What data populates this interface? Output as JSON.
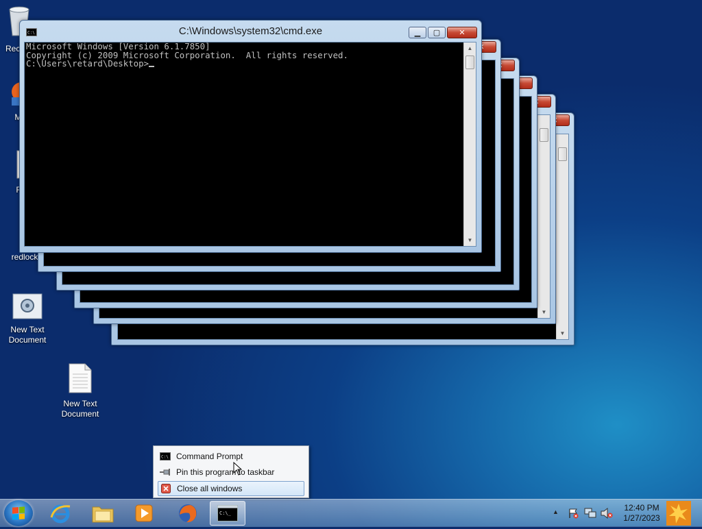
{
  "desktop": {
    "icons": [
      {
        "label": "Rec"
      },
      {
        "label": "M F"
      },
      {
        "label": "RE"
      },
      {
        "label": "redlock"
      },
      {
        "label": "New Text Document"
      },
      {
        "label": "New Text Document"
      }
    ]
  },
  "main_window": {
    "title": "C:\\Windows\\system32\\cmd.exe",
    "console_lines": [
      "Microsoft Windows [Version 6.1.7850]",
      "Copyright (c) 2009 Microsoft Corporation.  All rights reserved.",
      "",
      "C:\\Users\\retard\\Desktop>"
    ]
  },
  "jump_list": {
    "items": [
      {
        "label": "Command Prompt",
        "icon": "cmd-icon"
      },
      {
        "label": "Pin this program to taskbar",
        "icon": "pin-icon"
      },
      {
        "label": "Close all windows",
        "icon": "close-windows-icon"
      }
    ]
  },
  "taskbar": {
    "pinned": [
      "internet-explorer",
      "windows-explorer",
      "media-player",
      "firefox",
      "command-prompt"
    ],
    "clock": {
      "time": "12:40 PM",
      "date": "1/27/2023"
    }
  },
  "colors": {
    "console_bg": "#000000",
    "console_fg": "#c0c0c0",
    "close_red": "#c74a34"
  }
}
